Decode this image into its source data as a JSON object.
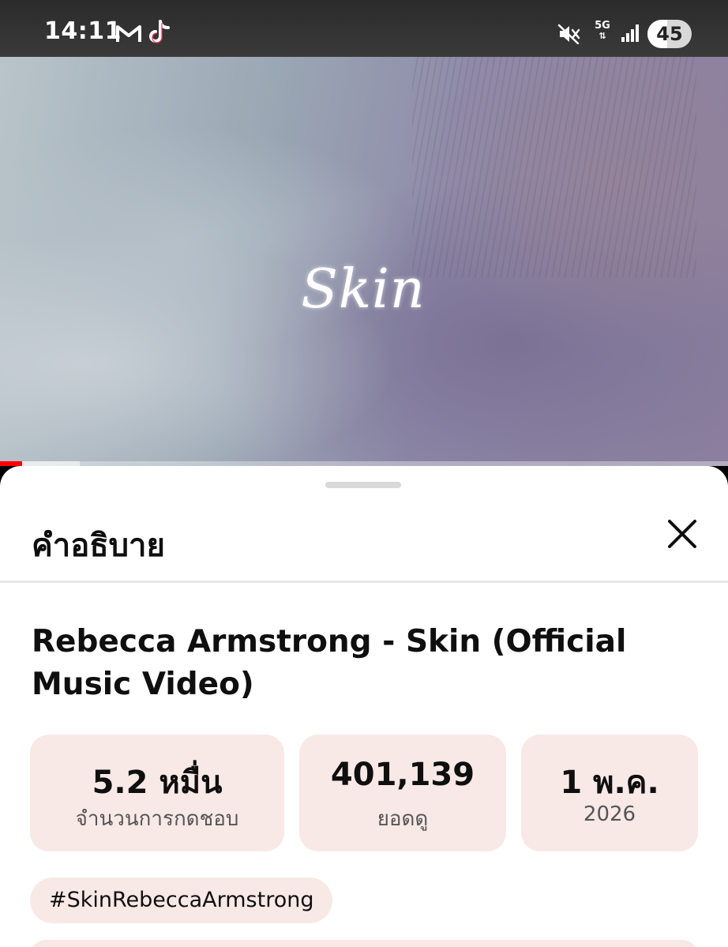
{
  "status_bar": {
    "time": "14:11",
    "network": "5G",
    "battery": "45",
    "icons": [
      "gmail-icon",
      "tiktok-icon",
      "mute-icon",
      "signal-icon",
      "battery-icon"
    ]
  },
  "video": {
    "overlay_title": "Skin",
    "progress_fraction": 0.03,
    "buffered_fraction": 0.11,
    "colors": {
      "progress": "#ff0000"
    }
  },
  "sheet": {
    "title": "คำอธิบาย",
    "close_icon": "close-icon",
    "video_title": "Rebecca Armstrong - Skin (Official Music Video)",
    "stats": {
      "likes": {
        "value": "5.2 หมื่น",
        "label": "จำนวนการกดชอบ"
      },
      "views": {
        "value": "401,139",
        "label": "ยอดดู"
      },
      "date": {
        "value": "1 พ.ค.",
        "label": "2026"
      }
    },
    "hashtag": "#SkinRebeccaArmstrong",
    "colors": {
      "chip_bg": "#f8e9e6",
      "text": "#0f0f0f"
    }
  }
}
